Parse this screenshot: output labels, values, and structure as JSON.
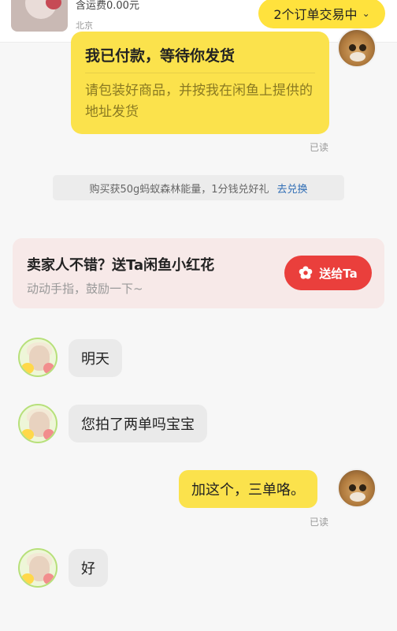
{
  "header": {
    "shipping": "含运费0.00元",
    "location": "北京",
    "order_pill": "2个订单交易中",
    "chevron": "⌄"
  },
  "paid_card": {
    "title": "我已付款，等待你发货",
    "description": "请包装好商品，并按我在闲鱼上提供的地址发货",
    "read": "已读"
  },
  "promo": {
    "text": "购买获50g蚂蚁森林能量，1分钱兑好礼",
    "link": "去兑换"
  },
  "flower_card": {
    "title": "卖家人不错？送Ta闲鱼小红花",
    "subtitle": "动动手指，鼓励一下~",
    "button": "送给Ta"
  },
  "messages": [
    {
      "from": "seller",
      "text": "明天"
    },
    {
      "from": "seller",
      "text": "您拍了两单吗宝宝"
    },
    {
      "from": "me",
      "text": "加这个，三单咯。",
      "read": "已读"
    },
    {
      "from": "seller",
      "text": "好"
    }
  ],
  "colors": {
    "accent_yellow": "#ffe23d",
    "bubble_yellow": "#fbe24c",
    "red_button": "#ea3f3c",
    "link_blue": "#2f6db5"
  },
  "icons": [
    "chevron-down-icon",
    "flower-icon",
    "buyer-avatar",
    "seller-avatar"
  ]
}
